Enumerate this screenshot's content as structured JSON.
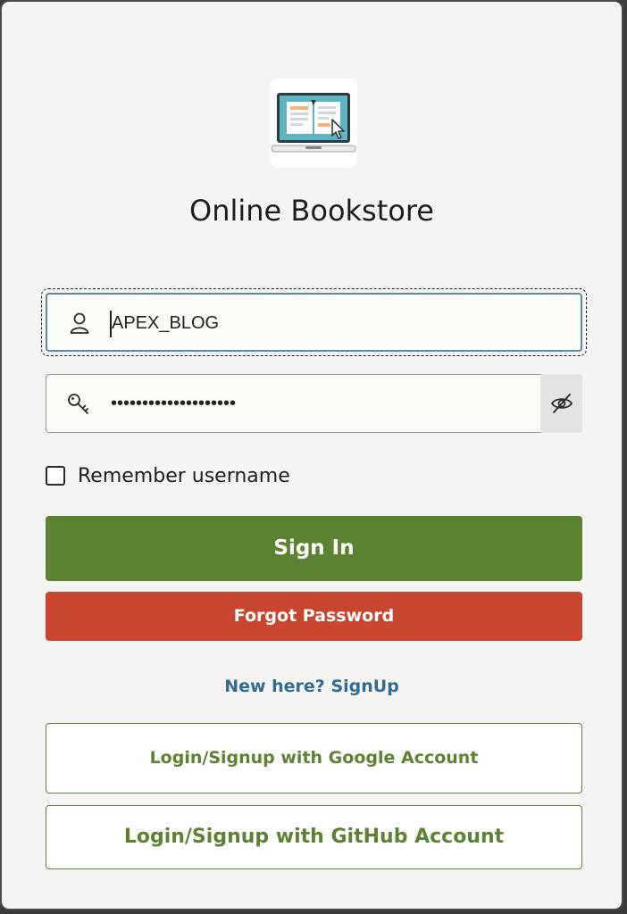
{
  "app": {
    "title": "Online Bookstore"
  },
  "login_form": {
    "username": {
      "value": "APEX_BLOG",
      "icon": "user-icon"
    },
    "password": {
      "value": "••••••••••••••••••••",
      "icon": "key-icon",
      "toggle_icon": "eye-slash-icon"
    },
    "remember": {
      "label": "Remember username",
      "checked": false
    },
    "sign_in_label": "Sign In",
    "forgot_label": "Forgot Password",
    "signup_link": "New here? SignUp",
    "google_label": "Login/Signup with Google Account",
    "github_label": "Login/Signup with GitHub Account"
  },
  "colors": {
    "primary_green": "#5b8332",
    "danger_red": "#c84630",
    "link_blue": "#2f6d94",
    "field_bg": "#f8fcf4",
    "page_bg": "#f5f4f2"
  }
}
